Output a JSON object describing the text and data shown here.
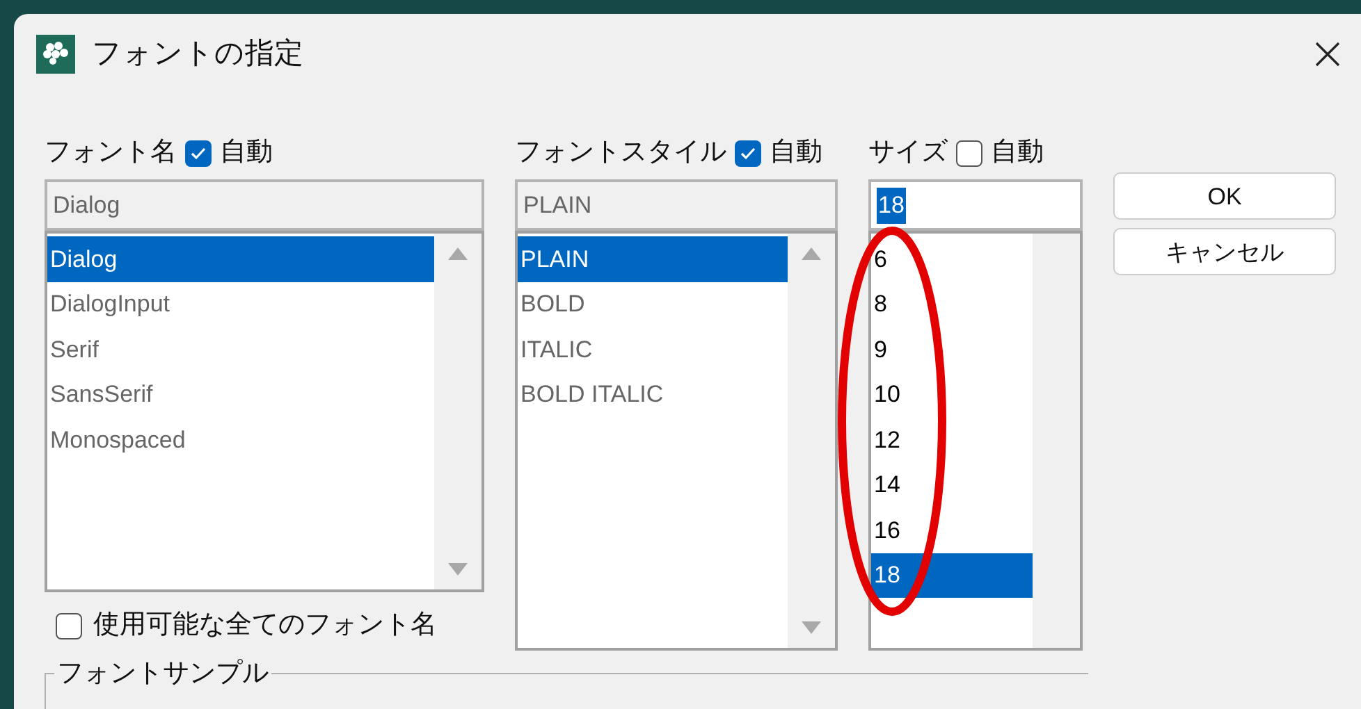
{
  "window": {
    "title": "フォントの指定"
  },
  "font_name": {
    "label": "フォント名",
    "auto_label": "自動",
    "auto_checked": true,
    "value": "Dialog",
    "items": [
      {
        "label": "Dialog",
        "selected": true
      },
      {
        "label": "DialogInput",
        "selected": false
      },
      {
        "label": "Serif",
        "selected": false
      },
      {
        "label": "SansSerif",
        "selected": false
      },
      {
        "label": "Monospaced",
        "selected": false
      }
    ],
    "all_fonts": {
      "label": "使用可能な全てのフォント名",
      "checked": false
    }
  },
  "font_style": {
    "label": "フォントスタイル",
    "auto_label": "自動",
    "auto_checked": true,
    "value": "PLAIN",
    "items": [
      {
        "label": "PLAIN",
        "selected": true
      },
      {
        "label": "BOLD",
        "selected": false
      },
      {
        "label": "ITALIC",
        "selected": false
      },
      {
        "label": "BOLD ITALIC",
        "selected": false
      }
    ]
  },
  "size": {
    "label": "サイズ",
    "auto_label": "自動",
    "auto_checked": false,
    "value": "18",
    "items": [
      {
        "label": "6",
        "selected": false
      },
      {
        "label": "8",
        "selected": false
      },
      {
        "label": "9",
        "selected": false
      },
      {
        "label": "10",
        "selected": false
      },
      {
        "label": "12",
        "selected": false
      },
      {
        "label": "14",
        "selected": false
      },
      {
        "label": "16",
        "selected": false
      },
      {
        "label": "18",
        "selected": true
      }
    ]
  },
  "buttons": [
    "OK",
    "キャンセル"
  ],
  "sample_group": {
    "label": "フォントサンプル"
  }
}
